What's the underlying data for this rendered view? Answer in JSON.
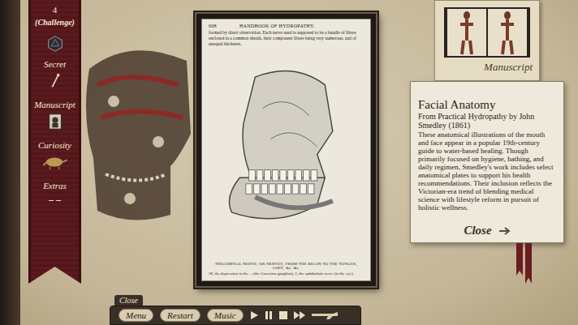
{
  "ribbon": {
    "level_number": "4",
    "mode": "(Challenge)",
    "items": [
      {
        "label": "Secret",
        "kind": "secret"
      },
      {
        "label": "Manuscript",
        "kind": "manuscript"
      },
      {
        "label": "Curiosity",
        "kind": "curiosity"
      },
      {
        "label": "Extras",
        "kind": "extras"
      }
    ],
    "extras_value": "– –"
  },
  "document": {
    "page_number": "608",
    "running_head": "HANDBOOK OF HYDROPATHY.",
    "intro": "formed by direct observation. Each nerve used is supposed to be a bundle of fibres enclosed in a common sheath, their component fibres being very numerous, and of unequal thickness.",
    "caption": "TRIGEMINAL NERVE, OR NERVES, FROM THE BRAIN TO THE TONGUE, JAWS, &c. &c.",
    "legend": "28, the depression in the ... (the Casserian ganglion), 2, the ophthalmic nerve (to the eye)."
  },
  "manuscript_card": {
    "label": "Manuscript"
  },
  "info": {
    "title": "Facial Anatomy",
    "subtitle": "From Practical Hydropathy by John Smedley (1861)",
    "description": "These anatomical illustrations of the mouth and face appear in a popular 19th-century guide to water-based healing. Though primarily focused on hygiene, bathing, and daily regimen, Smedley's work includes select anatomical plates to support his health recommendations. Their inclusion reflects the Victorian-era trend of blending medical science with lifestyle reform in pursuit of holistic wellness.",
    "close": "Close"
  },
  "toolbar": {
    "close_tab": "Close",
    "buttons": [
      "Menu",
      "Restart",
      "Music"
    ]
  }
}
